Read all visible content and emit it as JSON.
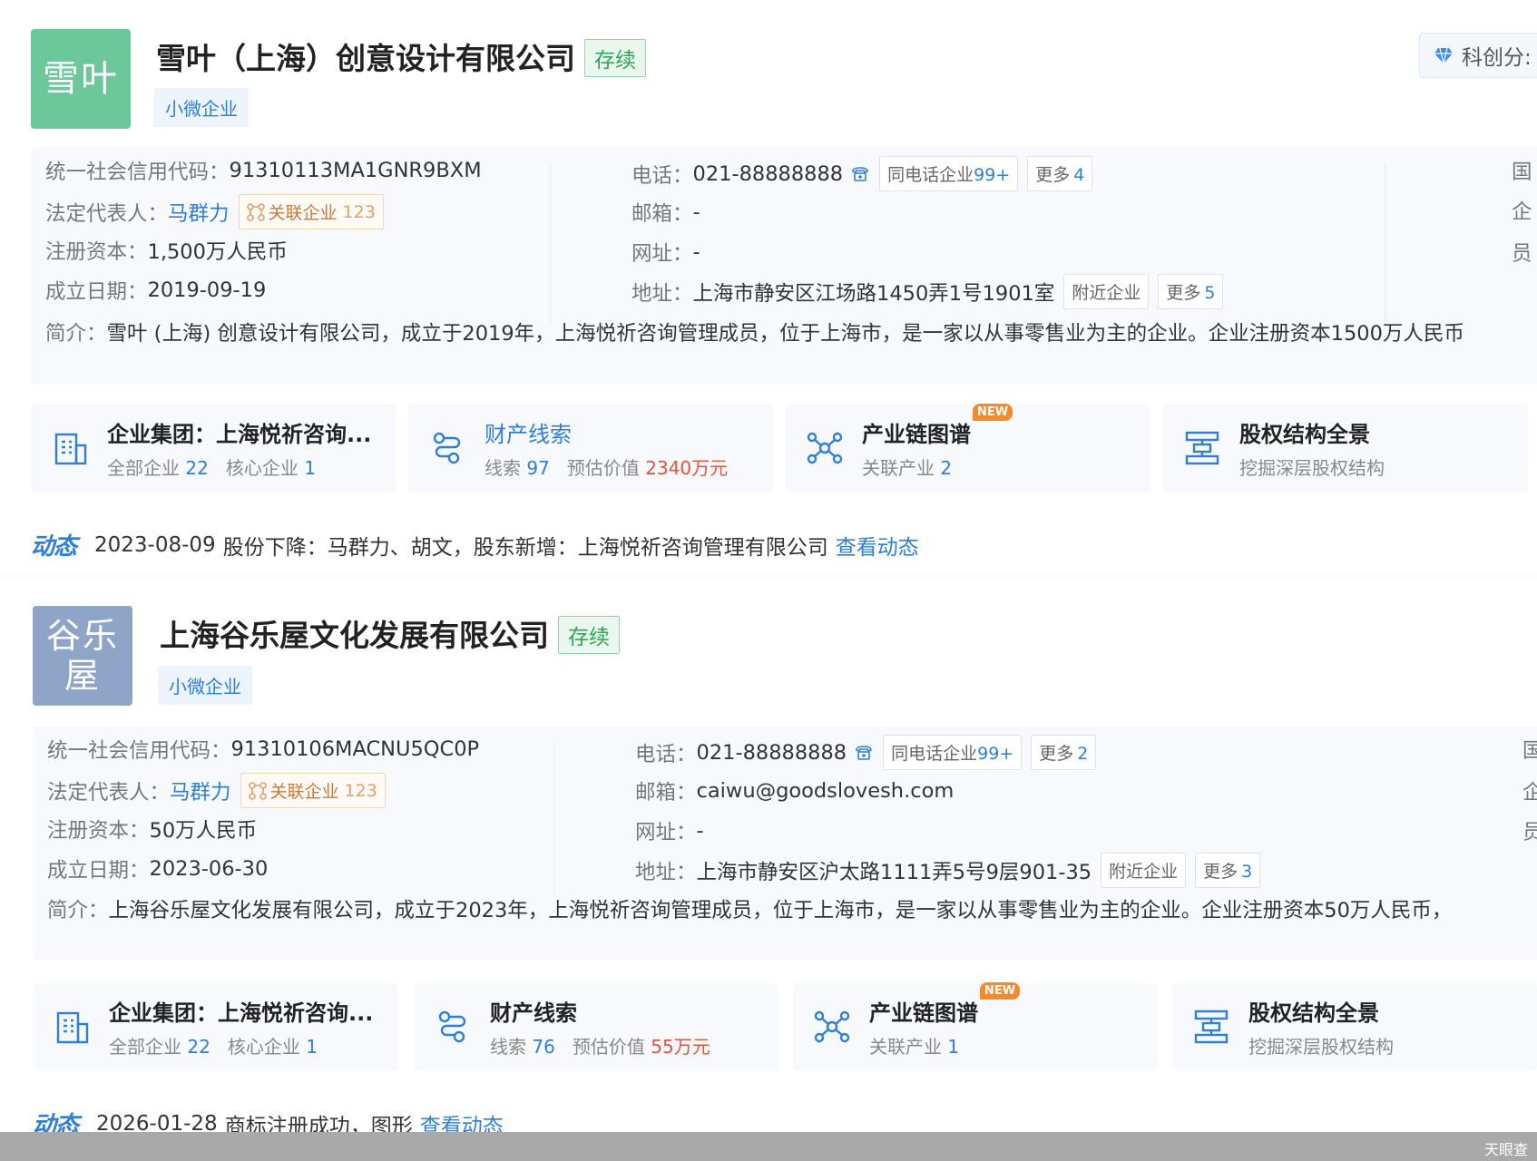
{
  "companies": [
    {
      "logo_text": "雪叶",
      "name": "雪叶（上海）创意设计有限公司",
      "status": "存续",
      "tag": "小微企业",
      "score_label": "科创分:",
      "credit_label": "统一社会信用代码：",
      "credit_code": "91310113MA1GNR9BXM",
      "legal_label": "法定代表人：",
      "legal_rep": "马群力",
      "related_label": "关联企业",
      "related_count": "123",
      "capital_label": "注册资本：",
      "capital": "1,500万人民币",
      "date_label": "成立日期：",
      "founded": "2019-09-19",
      "phone_label": "电话：",
      "phone": "021-88888888",
      "same_phone_label": "同电话企业",
      "same_phone_count": "99+",
      "more_label": "更多",
      "phone_more": "4",
      "email_label": "邮箱：",
      "email": "-",
      "web_label": "网址：",
      "website": "-",
      "addr_label": "地址：",
      "address": "上海市静安区江场路1450弄1号1901室",
      "nearby_label": "附近企业",
      "addr_more": "5",
      "right_col": [
        "国",
        "企",
        "员"
      ],
      "intro_label": "简介：",
      "intro": "雪叶 (上海) 创意设计有限公司，成立于2019年，上海悦祈咨询管理成员，位于上海市，是一家以从事零售业为主的企业。企业注册资本1500万人民币",
      "features": {
        "group_title": "企业集团：上海悦祈咨询...",
        "group_all_label": "全部企业",
        "group_all": "22",
        "group_core_label": "核心企业",
        "group_core": "1",
        "asset_title": "财产线索",
        "asset_clues_label": "线索",
        "asset_clues": "97",
        "asset_value_label": "预估价值",
        "asset_value": "2340万元",
        "chain_title": "产业链图谱",
        "chain_new": "NEW",
        "chain_label": "关联产业",
        "chain_count": "2",
        "equity_title": "股权结构全景",
        "equity_sub": "挖掘深层股权结构"
      },
      "dynamic_badge": "动态",
      "dynamic_date": "2023-08-09",
      "dynamic_text": "股份下降：马群力、胡文，股东新增：上海悦祈咨询管理有限公司",
      "dynamic_link": "查看动态"
    },
    {
      "logo_text": "谷乐屋",
      "name": "上海谷乐屋文化发展有限公司",
      "status": "存续",
      "tag": "小微企业",
      "credit_label": "统一社会信用代码：",
      "credit_code": "91310106MACNU5QC0P",
      "legal_label": "法定代表人：",
      "legal_rep": "马群力",
      "related_label": "关联企业",
      "related_count": "123",
      "capital_label": "注册资本：",
      "capital": "50万人民币",
      "date_label": "成立日期：",
      "founded": "2023-06-30",
      "phone_label": "电话：",
      "phone": "021-88888888",
      "same_phone_label": "同电话企业",
      "same_phone_count": "99+",
      "more_label": "更多",
      "phone_more": "2",
      "email_label": "邮箱：",
      "email": "caiwu@goodslovesh.com",
      "web_label": "网址：",
      "website": "-",
      "addr_label": "地址：",
      "address": "上海市静安区沪太路1111弄5号9层901-35",
      "nearby_label": "附近企业",
      "addr_more": "3",
      "right_col": [
        "国",
        "企",
        "员"
      ],
      "intro_label": "简介：",
      "intro": "上海谷乐屋文化发展有限公司，成立于2023年，上海悦祈咨询管理成员，位于上海市，是一家以从事零售业为主的企业。企业注册资本50万人民币，",
      "features": {
        "group_title": "企业集团：上海悦祈咨询...",
        "group_all_label": "全部企业",
        "group_all": "22",
        "group_core_label": "核心企业",
        "group_core": "1",
        "asset_title": "财产线索",
        "asset_clues_label": "线索",
        "asset_clues": "76",
        "asset_value_label": "预估价值",
        "asset_value": "55万元",
        "chain_title": "产业链图谱",
        "chain_new": "NEW",
        "chain_label": "关联产业",
        "chain_count": "1",
        "equity_title": "股权结构全景",
        "equity_sub": "挖掘深层股权结构"
      },
      "dynamic_badge": "动态",
      "dynamic_date": "2026-01-28",
      "dynamic_text": "商标注册成功，图形",
      "dynamic_link": "查看动态"
    }
  ],
  "watermark": "天眼查",
  "colors": {
    "accent": "#2d7fd9",
    "status_green": "#2fa655",
    "logo1": "#6cc79b",
    "logo2": "#8ea5c8",
    "value_red": "#e5533c"
  }
}
